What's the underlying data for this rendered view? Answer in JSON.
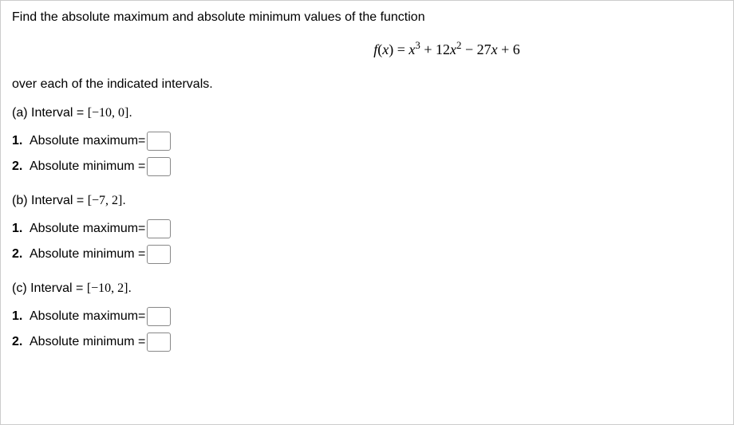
{
  "prompt": "Find the absolute maximum and absolute minimum values of the function",
  "formula_parts": {
    "lhs": "f",
    "lparen": "(",
    "xvar": "x",
    "rparen": ")",
    "eq": " = ",
    "t1_var": "x",
    "t1_exp": "3",
    "plus1": " + 12",
    "t2_var": "x",
    "t2_exp": "2",
    "minus": " − 27",
    "t3_var": "x",
    "plus2": " + 6"
  },
  "subprompt": "over each of the indicated intervals.",
  "parts": {
    "a": {
      "label": "(a) Interval = ",
      "interval": "[−10, 0]",
      "dot": ".",
      "q1_num": "1.",
      "q1_label": "Absolute maximum=",
      "q1_value": "",
      "q2_num": "2.",
      "q2_label": "Absolute minimum =",
      "q2_value": ""
    },
    "b": {
      "label": "(b) Interval = ",
      "interval": "[−7, 2]",
      "dot": ".",
      "q1_num": "1.",
      "q1_label": "Absolute maximum=",
      "q1_value": "",
      "q2_num": "2.",
      "q2_label": "Absolute minimum =",
      "q2_value": ""
    },
    "c": {
      "label": "(c) Interval = ",
      "interval": "[−10, 2]",
      "dot": ".",
      "q1_num": "1.",
      "q1_label": "Absolute maximum=",
      "q1_value": "",
      "q2_num": "2.",
      "q2_label": "Absolute minimum =",
      "q2_value": ""
    }
  }
}
